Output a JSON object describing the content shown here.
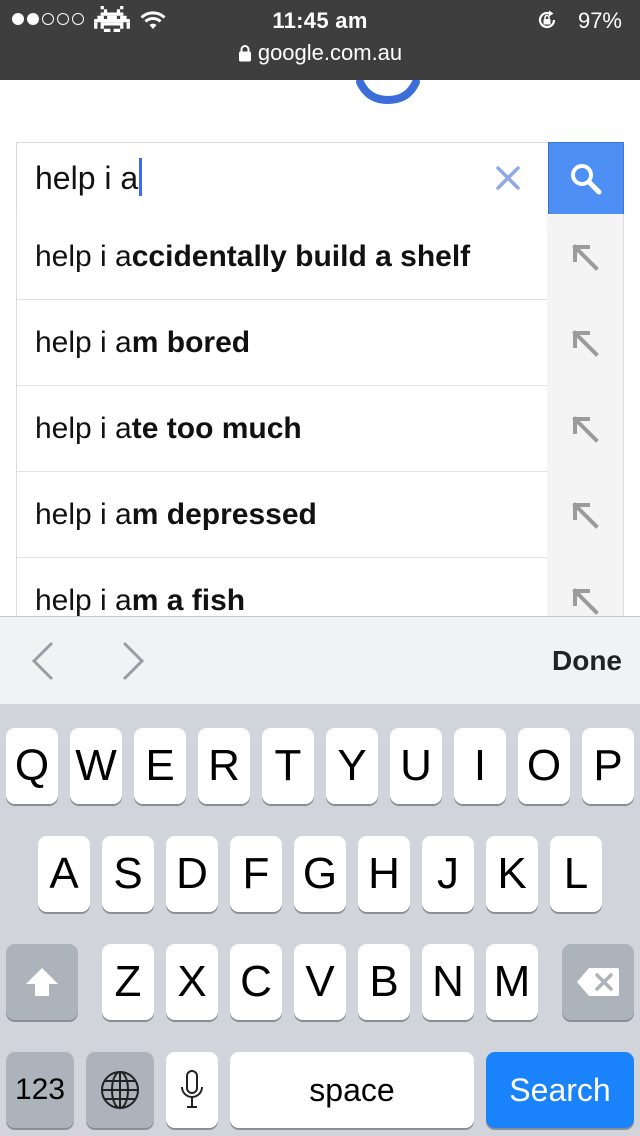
{
  "status_bar": {
    "time": "11:45 am",
    "battery": "97%",
    "url": "google.com.au"
  },
  "search": {
    "query": "help i a",
    "clear_icon": "clear-x-icon",
    "search_icon": "magnifier-icon",
    "accent": "#4d8ff4"
  },
  "suggestions": [
    {
      "prefix": "help i a",
      "completion": "ccidentally build a shelf"
    },
    {
      "prefix": "help i a",
      "completion": "m bored"
    },
    {
      "prefix": "help i a",
      "completion": "te too much"
    },
    {
      "prefix": "help i a",
      "completion": "m depressed"
    },
    {
      "prefix": "help i a",
      "completion": "m a fish"
    }
  ],
  "toolbar": {
    "done_label": "Done"
  },
  "keyboard": {
    "row1": [
      "Q",
      "W",
      "E",
      "R",
      "T",
      "Y",
      "U",
      "I",
      "O",
      "P"
    ],
    "row2": [
      "A",
      "S",
      "D",
      "F",
      "G",
      "H",
      "J",
      "K",
      "L"
    ],
    "row3": [
      "Z",
      "X",
      "C",
      "V",
      "B",
      "N",
      "M"
    ],
    "num_label": "123",
    "space_label": "space",
    "search_label": "Search",
    "search_color": "#1a82fb"
  }
}
